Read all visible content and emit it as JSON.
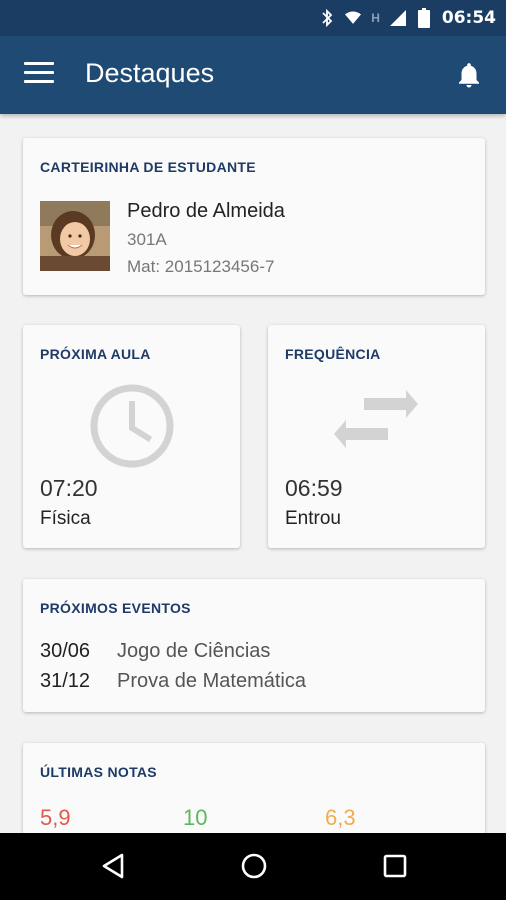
{
  "status_bar": {
    "time": "06:54",
    "network_letter": "H",
    "icons": [
      "bluetooth-icon",
      "wifi-icon",
      "signal-icon",
      "battery-icon"
    ]
  },
  "app_bar": {
    "title": "Destaques",
    "icons": [
      "menu-icon",
      "bell-icon"
    ]
  },
  "student_card": {
    "title": "CARTEIRINHA DE ESTUDANTE",
    "name": "Pedro de Almeida",
    "class": "301A",
    "registration": "Mat: 2015123456-7"
  },
  "next_class": {
    "title": "PRÓXIMA AULA",
    "time": "07:20",
    "subject": "Física",
    "icon": "clock-icon"
  },
  "attendance": {
    "title": "FREQUÊNCIA",
    "time": "06:59",
    "status": "Entrou",
    "icon": "swap-arrows-icon"
  },
  "events": {
    "title": "PRÓXIMOS EVENTOS",
    "items": [
      {
        "date": "30/06",
        "name": "Jogo de Ciências"
      },
      {
        "date": "31/12",
        "name": "Prova de Matemática"
      }
    ]
  },
  "grades": {
    "title": "ÚLTIMAS NOTAS",
    "items": [
      {
        "value": "5,9",
        "color": "#e05a4e"
      },
      {
        "value": "10",
        "color": "#5cb85c"
      },
      {
        "value": "6,3",
        "color": "#f0ad4e"
      }
    ]
  },
  "colors": {
    "status_bar": "#1b3d63",
    "app_bar": "#1e4a74",
    "card_title": "#1e3a66"
  }
}
